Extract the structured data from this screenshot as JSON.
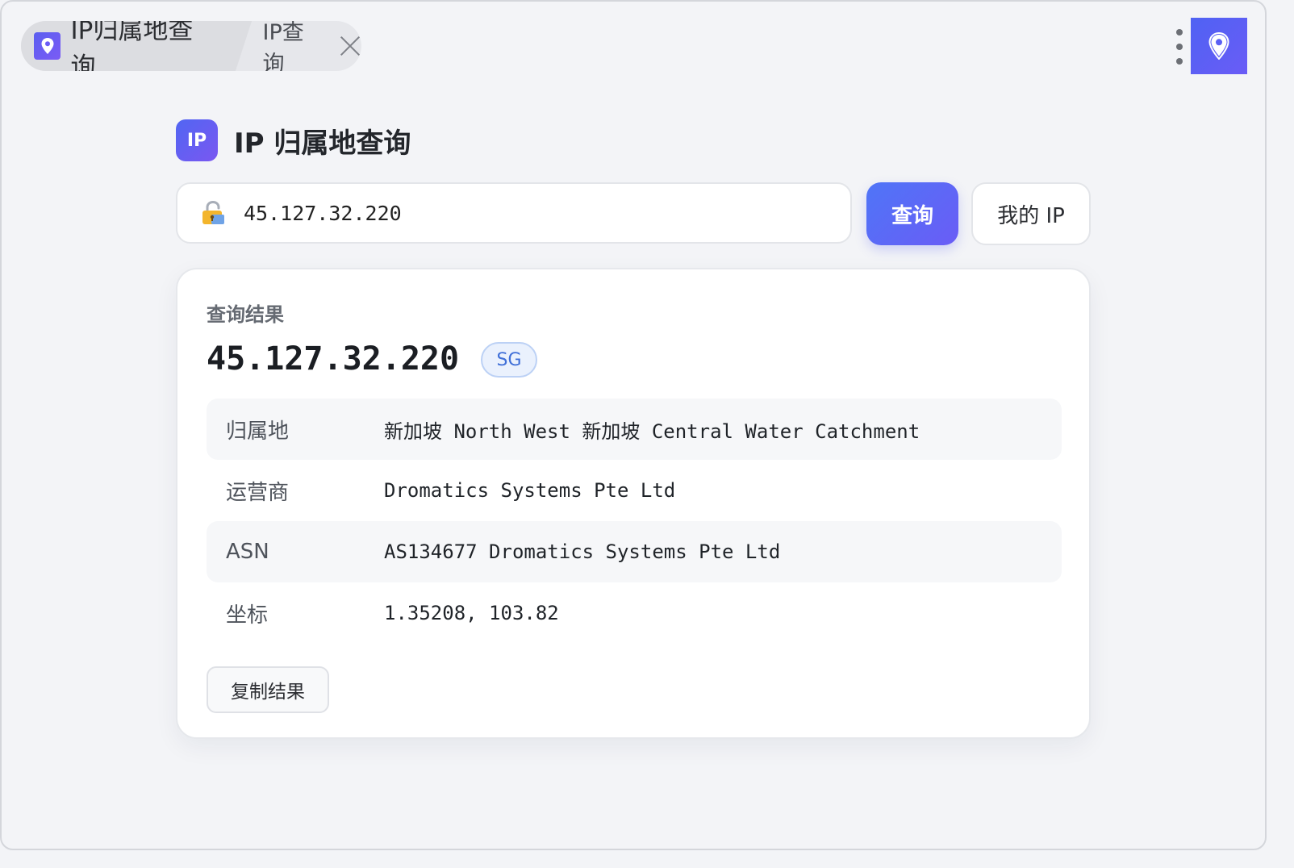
{
  "tabbar": {
    "app_title": "IP归属地查询",
    "page_tab": "IP查询"
  },
  "header": {
    "logo_text": "IP",
    "title": "IP 归属地查询"
  },
  "search": {
    "value": "45.127.32.220",
    "query_label": "查询",
    "myip_label": "我的 IP"
  },
  "result": {
    "section_label": "查询结果",
    "ip": "45.127.32.220",
    "country_code": "SG",
    "rows": [
      {
        "key": "归属地",
        "value": "新加坡 North West 新加坡 Central Water Catchment"
      },
      {
        "key": "运营商",
        "value": "Dromatics Systems Pte Ltd"
      },
      {
        "key": "ASN",
        "value": "AS134677 Dromatics Systems Pte Ltd"
      },
      {
        "key": "坐标",
        "value": "1.35208, 103.82"
      }
    ],
    "copy_label": "复制结果"
  },
  "colors": {
    "accent": "#5b63f3",
    "badge_text": "#3f6fd8"
  },
  "icons": {
    "app": "location-pin-icon",
    "lock": "lock-icon",
    "more": "more-vertical-icon",
    "close": "close-icon"
  }
}
